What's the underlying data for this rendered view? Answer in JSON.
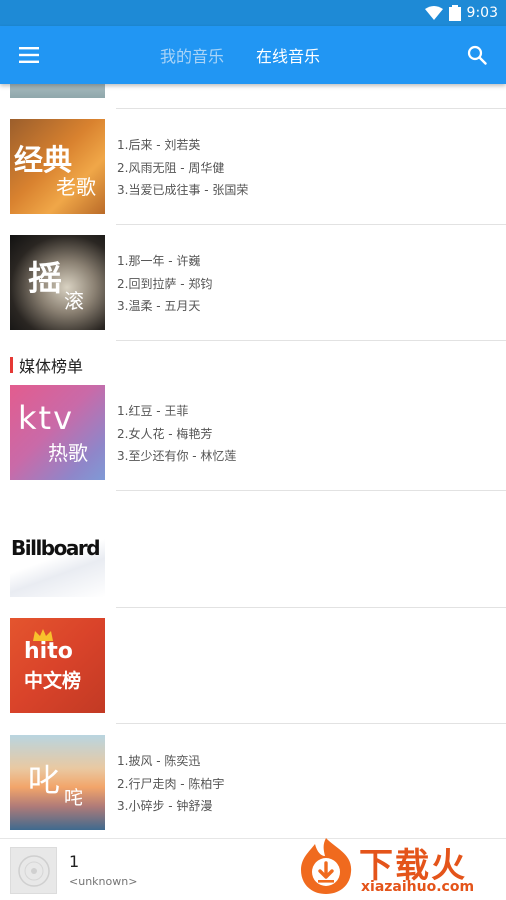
{
  "status_bar": {
    "time": "9:03",
    "icons": [
      "wifi-icon",
      "battery-icon"
    ]
  },
  "app_bar": {
    "menu_icon": "menu-icon",
    "tabs": [
      {
        "label": "我的音乐",
        "active": false
      },
      {
        "label": "在线音乐",
        "active": true
      }
    ],
    "search_icon": "search-icon"
  },
  "charts": [
    {
      "cover_big": "经典",
      "cover_small": "老歌",
      "songs": [
        "1.后来 - 刘若英",
        "2.风雨无阻 - 周华健",
        "3.当爱已成往事 - 张国荣"
      ]
    },
    {
      "cover_big": "摇",
      "cover_small": "滚",
      "songs": [
        "1.那一年 - 许巍",
        "2.回到拉萨 - 郑钧",
        "3.温柔 - 五月天"
      ]
    }
  ],
  "media_section": {
    "title": "媒体榜单",
    "items": [
      {
        "cover_big": "ktv",
        "cover_small": "热歌",
        "songs": [
          "1.红豆 - 王菲",
          "2.女人花 - 梅艳芳",
          "3.至少还有你 - 林忆莲"
        ]
      },
      {
        "cover_logo": "Billboard",
        "songs": []
      },
      {
        "cover_logo": "hito",
        "cover_small": "中文榜",
        "songs": []
      },
      {
        "cover_big": "叱",
        "cover_small": "咤",
        "songs": [
          "1.披风 - 陈奕迅",
          "2.行尸走肉 - 陈柏宇",
          "3.小碎步 - 钟舒漫"
        ]
      }
    ]
  },
  "player": {
    "title": "1",
    "artist": "<unknown>"
  },
  "watermark": {
    "text": "下载火",
    "domain": "xiazaihuo.com"
  },
  "colors": {
    "primary": "#2196f3",
    "status": "#1e8ad6",
    "accent_red": "#e53935"
  }
}
